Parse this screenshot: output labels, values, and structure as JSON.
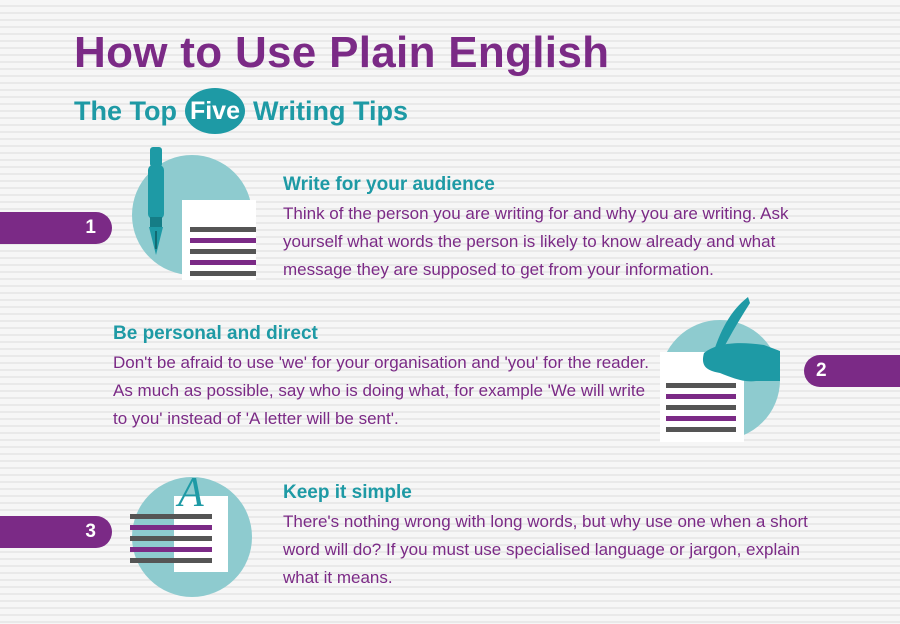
{
  "header": {
    "title": "How to Use Plain English",
    "subtitle_before": "The Top",
    "subtitle_highlight": "Five",
    "subtitle_after": "Writing Tips"
  },
  "tips": [
    {
      "number": "1",
      "title": "Write for your audience",
      "body": "Think of the person you are writing for and why you are writing. Ask yourself what words the person is likely to know already and what message they are supposed to get from your information.",
      "icon": "fountain-pen-icon"
    },
    {
      "number": "2",
      "title": "Be personal and direct",
      "body": "Don't be afraid to use 'we' for your organisation and 'you' for the reader. As much as possible, say who is doing what, for example 'We will write to you' instead of 'A letter will be sent'.",
      "icon": "hand-quill-icon"
    },
    {
      "number": "3",
      "title": "Keep it simple",
      "body": "There's nothing wrong with long words, but why use one when a short word will do? If you must use specialised language or jargon, explain what it means.",
      "icon": "letter-a-document-icon"
    }
  ],
  "colors": {
    "purple": "#7b2a86",
    "teal": "#1e9aa5",
    "light_teal": "#8ecbcf",
    "line_dark": "#555555"
  }
}
